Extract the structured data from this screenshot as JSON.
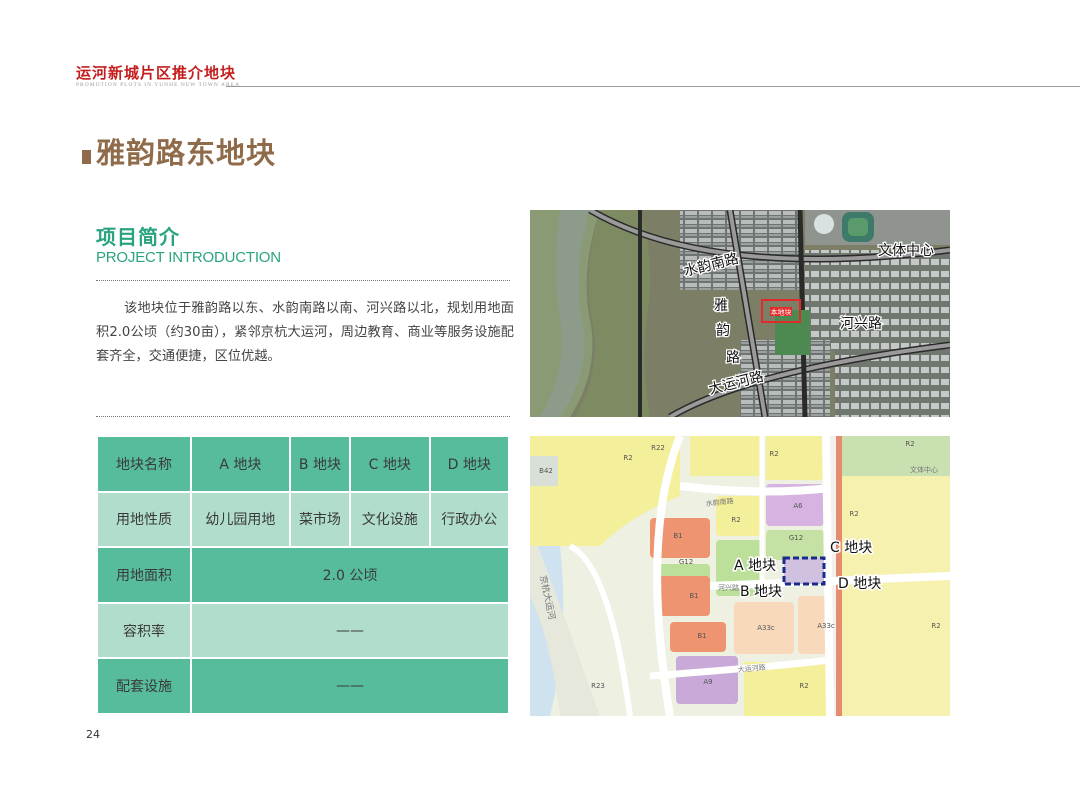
{
  "header": {
    "title": "运河新城片区推介地块",
    "subtitle": "PROMOTION PLOTS IN YUNHE NEW TOWN AREA"
  },
  "page_title": "雅韵路东地块",
  "intro": {
    "heading_zh": "项目简介",
    "heading_en": "PROJECT INTRODUCTION",
    "text": "该地块位于雅韵路以东、水韵南路以南、河兴路以北，规划用地面积2.0公顷（约30亩），紧邻京杭大运河，周边教育、商业等服务设施配套齐全，交通便捷，区位优越。"
  },
  "table": {
    "row1": [
      "地块名称",
      "A 地块",
      "B 地块",
      "C 地块",
      "D 地块"
    ],
    "row2": [
      "用地性质",
      "幼儿园用地",
      "菜市场",
      "文化设施",
      "行政办公"
    ],
    "row3": [
      "用地面积",
      "2.0 公顷"
    ],
    "row4": [
      "容积率",
      "——"
    ],
    "row5": [
      "配套设施",
      "——"
    ]
  },
  "map_photo": {
    "labels": {
      "l1": "水韵南路",
      "l2": "文体中心",
      "l3a": "雅",
      "l3b": "韵",
      "l3c": "路",
      "l4": "河兴路",
      "l5": "大运河路",
      "l6": "本地块"
    }
  },
  "plan_map": {
    "labels": {
      "a": "A 地块",
      "b": "B 地块",
      "c": "C 地块",
      "d": "D 地块",
      "canal": "京杭大运河"
    },
    "codes": {
      "r2a": "R2",
      "r22": "R22",
      "r2b": "R2",
      "r2c": "R2",
      "b42": "B42",
      "a6": "A6",
      "b1a": "B1",
      "g12a": "G12",
      "b1b": "B1",
      "b1c": "B1",
      "g12b": "G12",
      "r2d": "R2",
      "r2e": "R2",
      "a33a": "A33c",
      "a33b": "A33c",
      "a9": "A9",
      "r23": "R23",
      "r2f": "R2",
      "r2g": "R2"
    },
    "road_labels": {
      "r1": "水韵南路",
      "r2": "河兴路",
      "r3": "大运河路",
      "r4": "文体中心"
    }
  },
  "page_number": "24"
}
